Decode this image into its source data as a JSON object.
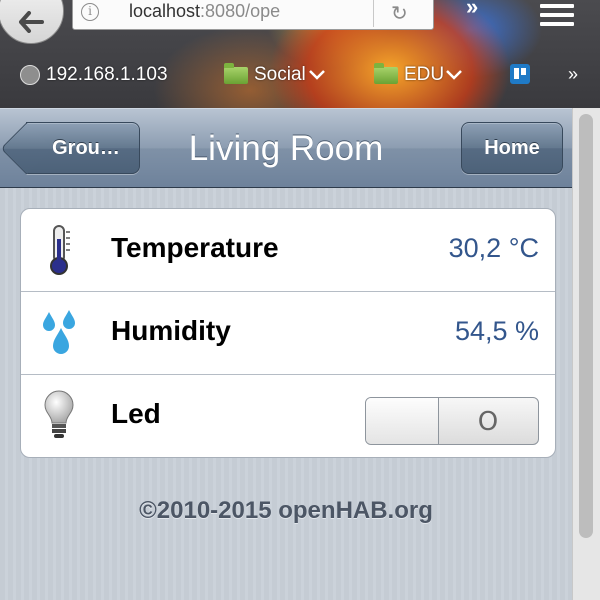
{
  "browser": {
    "url_host": "localhost",
    "url_rest": ":8080/ope",
    "bookmarks": [
      {
        "label": "192.168.1.103",
        "icon": "globe-icon"
      },
      {
        "label": "Social",
        "icon": "folder-icon",
        "dropdown": true
      },
      {
        "label": "EDU",
        "icon": "folder-icon",
        "dropdown": true
      }
    ],
    "overflow_glyph": "»"
  },
  "app": {
    "title": "Living Room",
    "back_label": "Grou…",
    "home_label": "Home",
    "items": [
      {
        "label": "Temperature",
        "value": "30,2 °C",
        "icon": "thermometer-icon"
      },
      {
        "label": "Humidity",
        "value": "54,5 %",
        "icon": "water-drops-icon"
      },
      {
        "label": "Led",
        "switch_state": "O",
        "icon": "lightbulb-icon"
      }
    ],
    "footer": "©2010-2015 openHAB.org"
  },
  "colors": {
    "toolbar": "#7f91a7",
    "value_text": "#33568c",
    "footer_text": "#4c5665"
  }
}
